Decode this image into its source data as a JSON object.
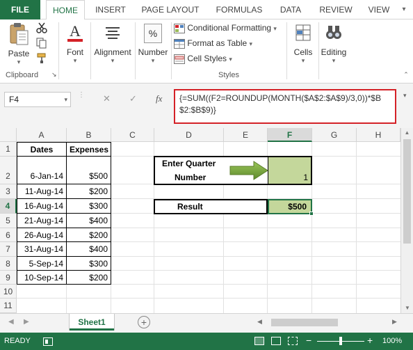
{
  "ribbon_tabs": [
    "FILE",
    "HOME",
    "INSERT",
    "PAGE LAYOUT",
    "FORMULAS",
    "DATA",
    "REVIEW",
    "VIEW"
  ],
  "ribbon": {
    "paste_label": "Paste",
    "clipboard_label": "Clipboard",
    "font_label": "Font",
    "alignment_label": "Alignment",
    "number_label": "Number",
    "percent_symbol": "%",
    "conditional_formatting": "Conditional Formatting",
    "format_as_table": "Format as Table",
    "cell_styles": "Cell Styles",
    "styles_label": "Styles",
    "cells_label": "Cells",
    "editing_label": "Editing"
  },
  "formula_bar": {
    "name_box": "F4",
    "cancel_symbol": "✕",
    "enter_symbol": "✓",
    "fx_symbol": "fx",
    "formula": "{=SUM((F2=ROUNDUP(MONTH($A$2:$A$9)/3,0))*$B$2:$B$9)}"
  },
  "columns": [
    "A",
    "B",
    "C",
    "D",
    "E",
    "F",
    "G",
    "H"
  ],
  "rows": [
    "1",
    "2",
    "3",
    "4",
    "5",
    "6",
    "7",
    "8",
    "9",
    "10",
    "11"
  ],
  "table": {
    "headers": [
      "Dates",
      "Expenses"
    ],
    "rows": [
      [
        "6-Jan-14",
        "$500"
      ],
      [
        "11-Aug-14",
        "$200"
      ],
      [
        "16-Aug-14",
        "$300"
      ],
      [
        "21-Aug-14",
        "$400"
      ],
      [
        "26-Aug-14",
        "$200"
      ],
      [
        "31-Aug-14",
        "$400"
      ],
      [
        "5-Sep-14",
        "$300"
      ],
      [
        "10-Sep-14",
        "$200"
      ]
    ]
  },
  "quarter_box": {
    "label_line1": "Enter Quarter",
    "label_line2": "Number",
    "value": "1"
  },
  "result_box": {
    "label": "Result",
    "value": "$500"
  },
  "sheet_tab": "Sheet1",
  "add_sheet_symbol": "+",
  "status": {
    "ready": "READY",
    "zoom": "100%",
    "zoom_minus": "−",
    "zoom_plus": "+"
  },
  "colors": {
    "excel_green": "#217346",
    "highlight_green": "#c4d79b",
    "arrow_green": "#77a33b",
    "formula_border_red": "#d42127"
  },
  "icons": [
    "cut-icon",
    "copy-icon",
    "format-painter-icon",
    "paste-icon",
    "font-icon",
    "alignment-icon",
    "number-icon",
    "conditional-formatting-icon",
    "format-as-table-icon",
    "cell-styles-icon",
    "cells-icon",
    "editing-icon",
    "green-arrow-icon",
    "add-sheet-icon",
    "macro-record-icon"
  ]
}
